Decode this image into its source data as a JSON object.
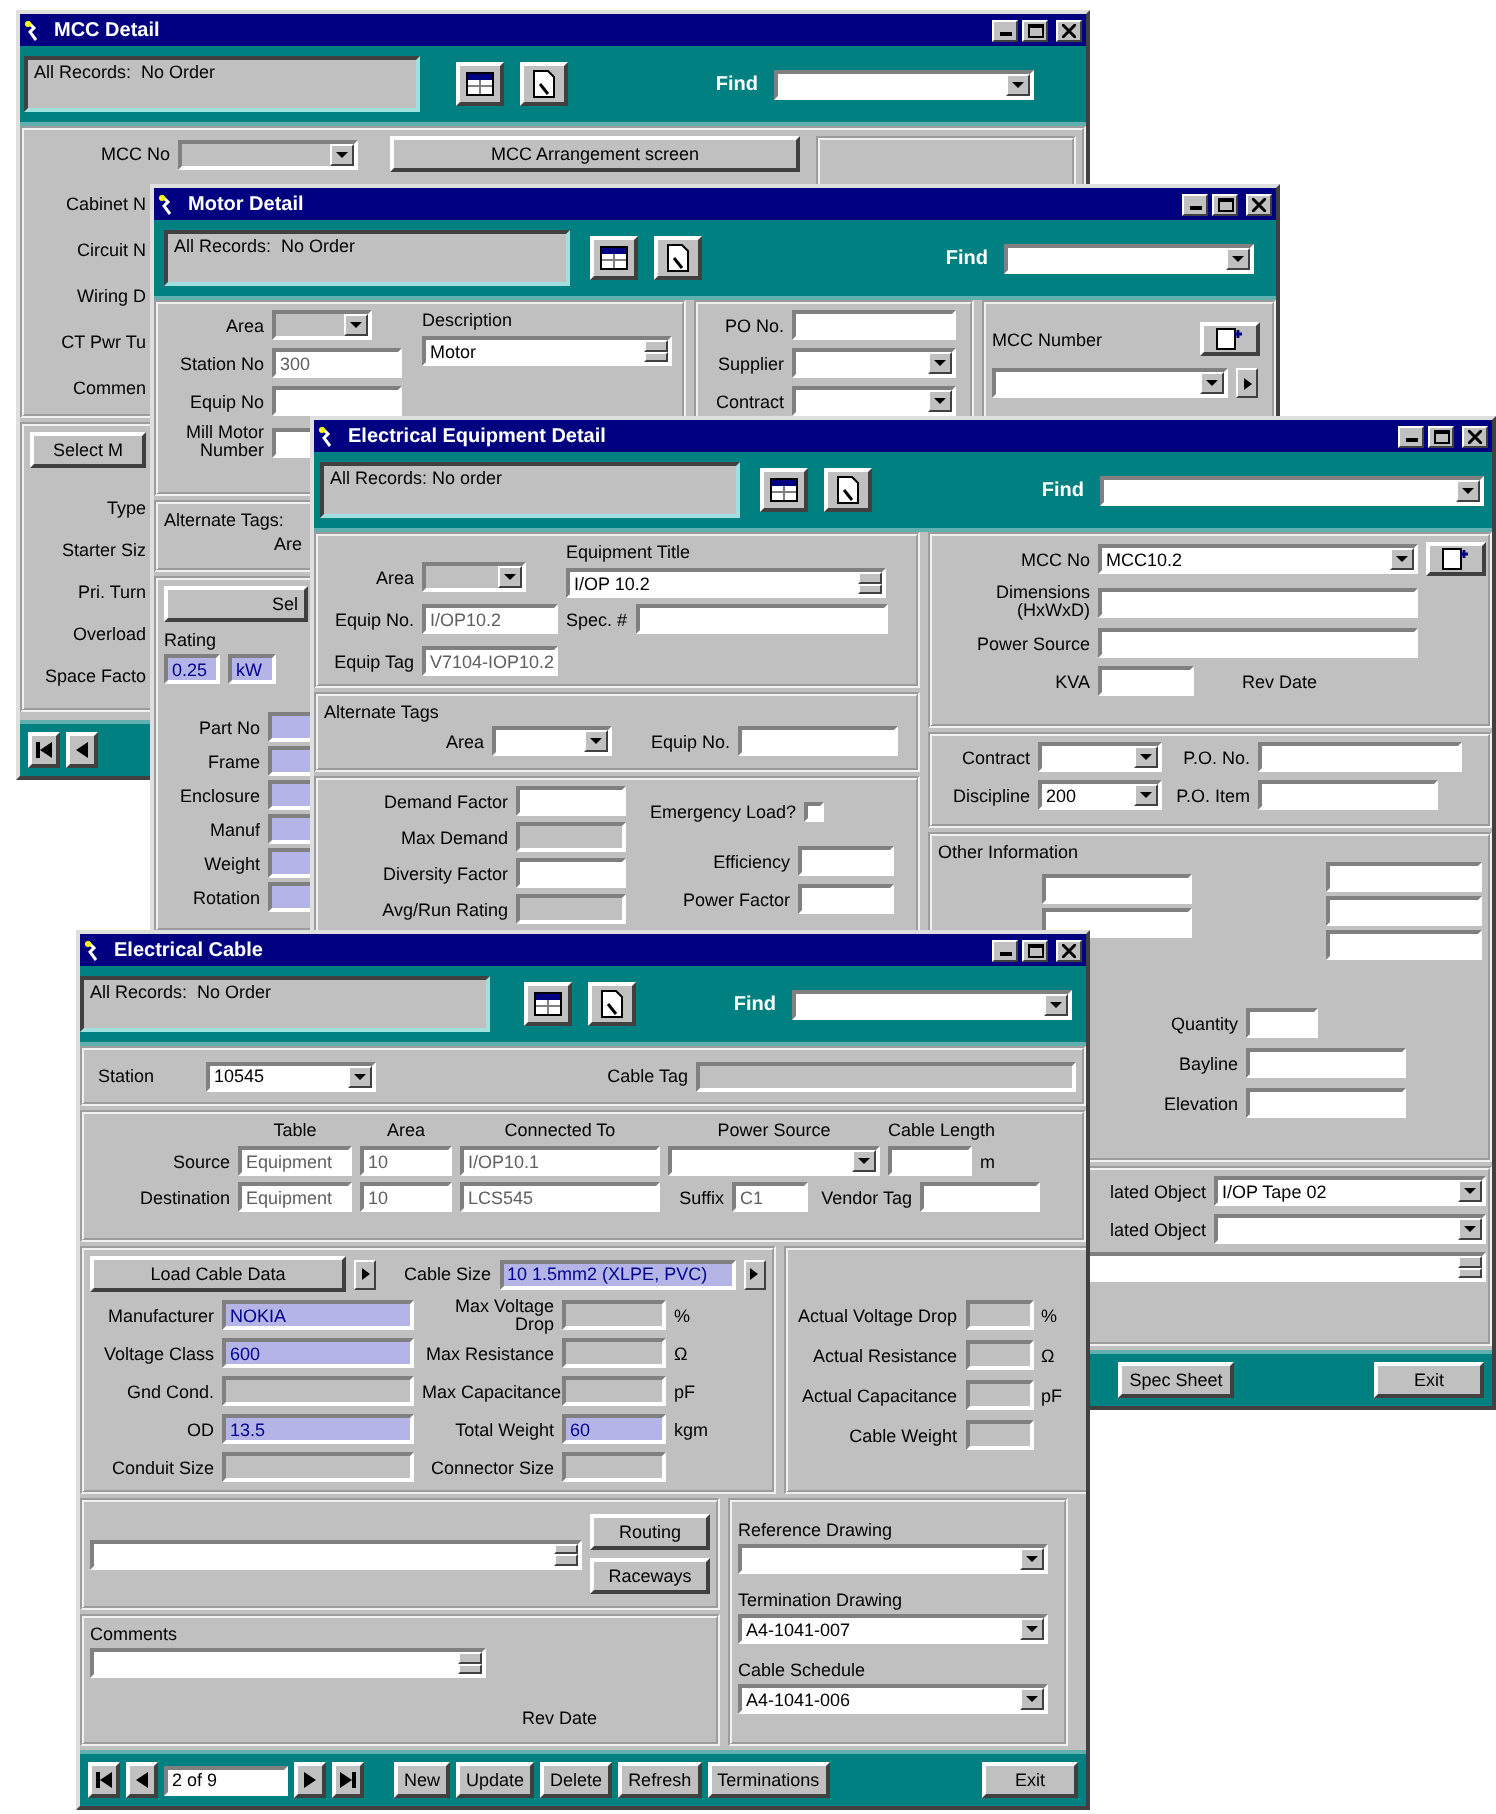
{
  "mcc_window": {
    "title": "MCC Detail",
    "status": "All Records:  No Order",
    "find_label": "Find",
    "find": {
      "kind": "combo"
    },
    "mcc_no": {
      "label": "MCC No",
      "field": {
        "kind": "locked_combo"
      }
    },
    "arrangement_button": "MCC Arrangement screen",
    "labels": [
      "Cabinet N",
      "Circuit N",
      "Wiring D",
      "CT Pwr Tu",
      "Commen"
    ],
    "select_button": "Select M",
    "starter_labels": [
      "Type",
      "Starter Siz",
      "Pri. Turn",
      "Overload",
      "Space Facto"
    ]
  },
  "motor_window": {
    "title": "Motor Detail",
    "status": "All Records:  No Order",
    "find_label": "Find",
    "find": {
      "kind": "combo"
    },
    "area": {
      "label": "Area",
      "field": {
        "kind": "locked_combo"
      }
    },
    "station_no": {
      "label": "Station No",
      "field": {
        "kind": "locked",
        "value": "300"
      }
    },
    "equip_no": {
      "label": "Equip No",
      "field": {
        "kind": "locked"
      }
    },
    "mill_motor_number": {
      "label": "Mill Motor Number",
      "field": {
        "kind": "text"
      }
    },
    "description": {
      "label": "Description",
      "field": {
        "kind": "memo",
        "value": "Motor"
      }
    },
    "po_no": {
      "label": "PO No.",
      "field": {
        "kind": "text"
      }
    },
    "supplier": {
      "label": "Supplier",
      "field": {
        "kind": "combo"
      }
    },
    "contract": {
      "label": "Contract",
      "field": {
        "kind": "combo"
      }
    },
    "mcc_number": {
      "label": "MCC Number",
      "field": {
        "kind": "combo"
      }
    },
    "alternate_tags": {
      "title": "Alternate Tags:",
      "area_label": "Are"
    },
    "select_button": "Sel",
    "rating": {
      "label": "Rating",
      "values": [
        {
          "kind": "linked",
          "value": "0.25"
        },
        {
          "kind": "linked",
          "value": "kW"
        }
      ]
    },
    "nameplate": [
      {
        "label": "Part No",
        "field": {
          "kind": "linked"
        }
      },
      {
        "label": "Frame",
        "field": {
          "kind": "linked"
        }
      },
      {
        "label": "Enclosure",
        "field": {
          "kind": "linked"
        }
      },
      {
        "label": "Manuf",
        "field": {
          "kind": "linked"
        }
      },
      {
        "label": "Weight",
        "field": {
          "kind": "linked"
        }
      },
      {
        "label": "Rotation",
        "field": {
          "kind": "linked"
        }
      }
    ]
  },
  "equipment_window": {
    "title": "Electrical Equipment Detail",
    "status": "All Records: No order",
    "find_label": "Find",
    "find": {
      "kind": "combo"
    },
    "area": {
      "label": "Area",
      "field": {
        "kind": "locked_combo"
      }
    },
    "equip_no": {
      "label": "Equip No.",
      "field": {
        "kind": "locked",
        "value": "I/OP10.2"
      }
    },
    "equip_tag": {
      "label": "Equip Tag",
      "field": {
        "kind": "locked",
        "value": "V7104-IOP10.2"
      }
    },
    "equipment_title": {
      "label": "Equipment Title",
      "field": {
        "kind": "memo",
        "value": "I/OP 10.2"
      }
    },
    "spec_no": {
      "label": "Spec. #",
      "field": {
        "kind": "text"
      }
    },
    "alternate_tags": {
      "title": "Alternate Tags",
      "area": {
        "label": "Area",
        "field": {
          "kind": "combo"
        }
      },
      "equip_no": {
        "label": "Equip No.",
        "field": {
          "kind": "text"
        }
      }
    },
    "loads": [
      {
        "label": "Demand Factor",
        "field": {
          "kind": "text"
        }
      },
      {
        "label": "Max Demand",
        "field": {
          "kind": "readonly"
        }
      },
      {
        "label": "Diversity Factor",
        "field": {
          "kind": "text"
        }
      },
      {
        "label": "Avg/Run Rating",
        "field": {
          "kind": "readonly"
        }
      }
    ],
    "emergency_load": {
      "label": "Emergency Load?",
      "checked": false
    },
    "efficiency": {
      "label": "Efficiency",
      "field": {
        "kind": "text"
      }
    },
    "power_factor": {
      "label": "Power Factor",
      "field": {
        "kind": "text"
      }
    },
    "mcc_no": {
      "label": "MCC No",
      "field": {
        "kind": "combo",
        "value": "MCC10.2"
      }
    },
    "dimensions": {
      "label": "Dimensions (HxWxD)",
      "field": {
        "kind": "text"
      }
    },
    "power_source": {
      "label": "Power Source",
      "field": {
        "kind": "text"
      }
    },
    "kva": {
      "label": "KVA",
      "field": {
        "kind": "text"
      }
    },
    "rev_date": {
      "label": "Rev Date"
    },
    "contract": {
      "label": "Contract",
      "field": {
        "kind": "combo"
      }
    },
    "po_no": {
      "label": "P.O. No.",
      "field": {
        "kind": "text"
      }
    },
    "discipline": {
      "label": "Discipline",
      "field": {
        "kind": "combo",
        "value": "200"
      }
    },
    "po_item": {
      "label": "P.O. Item",
      "field": {
        "kind": "text"
      }
    },
    "other_information": {
      "title": "Other Information",
      "middle_fields": [
        {
          "kind": "text"
        },
        {
          "kind": "text"
        }
      ],
      "right_fields": [
        {
          "kind": "text"
        },
        {
          "kind": "text"
        },
        {
          "kind": "text"
        }
      ]
    },
    "placement": [
      {
        "label": "Quantity",
        "field": {
          "kind": "text"
        }
      },
      {
        "label": "Bayline",
        "field": {
          "kind": "text"
        }
      },
      {
        "label": "Elevation",
        "field": {
          "kind": "text"
        }
      }
    ],
    "related_objects": [
      {
        "label": "lated Object",
        "field": {
          "kind": "combo",
          "value": "I/OP Tape 02"
        }
      },
      {
        "label": "lated Object",
        "field": {
          "kind": "combo"
        }
      }
    ],
    "notes": {
      "kind": "memo"
    },
    "buttons": [
      "Spec Sheet",
      "Exit"
    ]
  },
  "cable_window": {
    "title": "Electrical Cable",
    "status": "All Records:  No Order",
    "find_label": "Find",
    "find": {
      "kind": "combo"
    },
    "station": {
      "label": "Station",
      "field": {
        "kind": "combo",
        "value": "10545"
      }
    },
    "cable_tag": {
      "label": "Cable Tag",
      "field": {
        "kind": "readonly"
      }
    },
    "route_headers": [
      "Table",
      "Area",
      "Connected To",
      "Power Source",
      "Cable Length"
    ],
    "source": {
      "label": "Source",
      "table": {
        "kind": "locked",
        "value": "Equipment"
      },
      "area": {
        "kind": "locked",
        "value": "10"
      },
      "connected_to": {
        "kind": "locked",
        "value": "I/OP10.1"
      },
      "power_source": {
        "kind": "combo"
      },
      "cable_length": {
        "kind": "text"
      },
      "unit": "m"
    },
    "destination": {
      "label": "Destination",
      "table": {
        "kind": "locked",
        "value": "Equipment"
      },
      "area": {
        "kind": "locked",
        "value": "10"
      },
      "connected_to": {
        "kind": "locked",
        "value": "LCS545"
      },
      "suffix": {
        "label": "Suffix",
        "field": {
          "kind": "locked",
          "value": "C1"
        }
      },
      "vendor_tag": {
        "label": "Vendor Tag",
        "field": {
          "kind": "text"
        }
      }
    },
    "load_button": "Load Cable Data",
    "cable_size": {
      "label": "Cable Size",
      "field": {
        "kind": "linked",
        "value": "10 1.5mm2 (XLPE, PVC)"
      }
    },
    "properties": [
      {
        "label": "Manufacturer",
        "field": {
          "kind": "linked",
          "value": "NOKIA"
        }
      },
      {
        "label": "Voltage Class",
        "field": {
          "kind": "linked",
          "value": "600"
        }
      },
      {
        "label": "Gnd Cond.",
        "field": {
          "kind": "readonly"
        }
      },
      {
        "label": "OD",
        "field": {
          "kind": "linked",
          "value": "13.5"
        }
      },
      {
        "label": "Conduit Size",
        "field": {
          "kind": "readonly"
        }
      }
    ],
    "limits": [
      {
        "label": "Max Voltage Drop",
        "field": {
          "kind": "readonly"
        },
        "unit": "%"
      },
      {
        "label": "Max Resistance",
        "field": {
          "kind": "readonly"
        },
        "unit": "Ω"
      },
      {
        "label": "Max Capacitance",
        "field": {
          "kind": "readonly"
        },
        "unit": "pF"
      },
      {
        "label": "Total Weight",
        "field": {
          "kind": "linked",
          "value": "60"
        },
        "unit": "kgm"
      },
      {
        "label": "Connector Size",
        "field": {
          "kind": "readonly"
        }
      }
    ],
    "actuals": [
      {
        "label": "Actual Voltage Drop",
        "field": {
          "kind": "readonly"
        },
        "unit": "%"
      },
      {
        "label": "Actual Resistance",
        "field": {
          "kind": "readonly"
        },
        "unit": "Ω"
      },
      {
        "label": "Actual Capacitance",
        "field": {
          "kind": "readonly"
        },
        "unit": "pF"
      },
      {
        "label": "Cable Weight",
        "field": {
          "kind": "readonly"
        }
      }
    ],
    "routing_notes": {
      "kind": "memo"
    },
    "route_buttons": [
      "Routing",
      "Raceways"
    ],
    "comments": {
      "label": "Comments",
      "field": {
        "kind": "memo"
      }
    },
    "rev_date": {
      "label": "Rev Date"
    },
    "drawings": [
      {
        "label": "Reference Drawing",
        "field": {
          "kind": "combo"
        }
      },
      {
        "label": "Termination Drawing",
        "field": {
          "kind": "combo",
          "value": "A4-1041-007"
        }
      },
      {
        "label": "Cable Schedule",
        "field": {
          "kind": "combo",
          "value": "A4-1041-006"
        }
      }
    ],
    "record": "2 of 9",
    "buttons": [
      "New",
      "Update",
      "Delete",
      "Refresh",
      "Terminations",
      "Exit"
    ]
  }
}
